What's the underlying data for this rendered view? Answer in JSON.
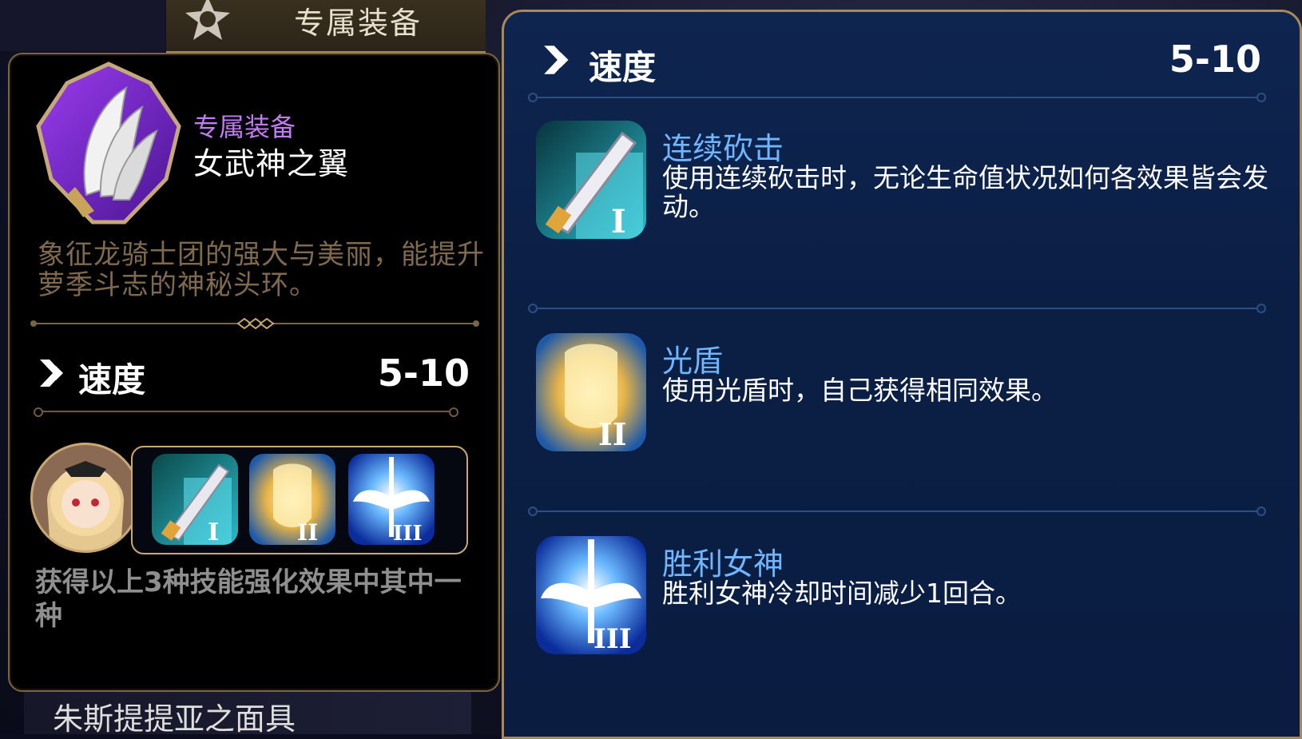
{
  "header": {
    "tab_label": "专属装备"
  },
  "item": {
    "category": "专属装备",
    "name": "女武神之翼",
    "description": "象征龙骑士团的强大与美丽，能提升萝季斗志的神秘头环。"
  },
  "stat": {
    "label": "速度",
    "value": "5-10"
  },
  "skill_summary": "获得以上3种技能强化效果中其中一种",
  "skills": [
    {
      "name": "连续砍击",
      "rank": "I",
      "icon": "sword-skill-icon",
      "description": "使用连续砍击时，无论生命值状况如何各效果皆会发动。"
    },
    {
      "name": "光盾",
      "rank": "II",
      "icon": "light-shield-skill-icon",
      "description": "使用光盾时，自己获得相同效果。"
    },
    {
      "name": "胜利女神",
      "rank": "III",
      "icon": "victory-goddess-skill-icon",
      "description": "胜利女神冷却时间减少1回合。"
    }
  ],
  "bottom_list_item": "朱斯提提亚之面具",
  "colors": {
    "category_purple": "#c07cf2",
    "description_gold": "#806a4e",
    "skill_name_blue": "#6fb6ff",
    "frame_gold": "#a8895a",
    "panel_blue": "#0e2550"
  }
}
